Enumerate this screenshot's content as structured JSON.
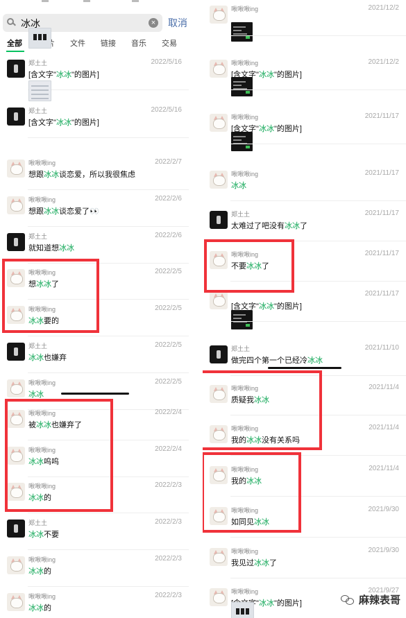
{
  "search": {
    "query": "冰冰",
    "cancel_label": "取消"
  },
  "tabs": [
    {
      "label": "全部",
      "active": true
    },
    {
      "label": "图片"
    },
    {
      "label": "文件"
    },
    {
      "label": "链接"
    },
    {
      "label": "音乐"
    },
    {
      "label": "交易"
    }
  ],
  "left_results": [
    {
      "sender": "郑土土",
      "date": "2022/5/16",
      "avatar": "black",
      "parts": [
        "[含文字\"",
        "冰冰",
        "\"的图片]"
      ],
      "thumb": "light"
    },
    {
      "sender": "郑土土",
      "date": "2022/5/16",
      "avatar": "black",
      "parts": [
        "[含文字\"",
        "冰冰",
        "\"的图片]"
      ],
      "thumb": "keys"
    },
    {
      "sender": "啾啾啾ing",
      "date": "2022/2/7",
      "avatar": "cat",
      "parts": [
        "想跟",
        "冰冰",
        "谈恋爱，所以我很焦虑"
      ]
    },
    {
      "sender": "啾啾啾ing",
      "date": "2022/2/6",
      "avatar": "cat",
      "parts": [
        "想跟",
        "冰冰",
        "谈恋爱了👀"
      ]
    },
    {
      "sender": "郑土土",
      "date": "2022/2/6",
      "avatar": "black",
      "parts": [
        "就知道想",
        "冰冰",
        ""
      ]
    },
    {
      "sender": "啾啾啾ing",
      "date": "2022/2/5",
      "avatar": "cat",
      "parts": [
        "想",
        "冰冰",
        "了"
      ]
    },
    {
      "sender": "啾啾啾ing",
      "date": "2022/2/5",
      "avatar": "cat",
      "parts": [
        "",
        "冰冰",
        "要的"
      ]
    },
    {
      "sender": "郑土土",
      "date": "2022/2/5",
      "avatar": "black",
      "parts": [
        "",
        "冰冰",
        "也嫌弃"
      ]
    },
    {
      "sender": "啾啾啾ing",
      "date": "2022/2/5",
      "avatar": "cat",
      "parts": [
        "",
        "冰冰",
        ""
      ]
    },
    {
      "sender": "啾啾啾ing",
      "date": "2022/2/4",
      "avatar": "cat",
      "parts": [
        "被",
        "冰冰",
        "也嫌弃了"
      ]
    },
    {
      "sender": "啾啾啾ing",
      "date": "2022/2/4",
      "avatar": "cat",
      "parts": [
        "",
        "冰冰",
        "呜呜"
      ]
    },
    {
      "sender": "啾啾啾ing",
      "date": "2022/2/3",
      "avatar": "cat",
      "parts": [
        "",
        "冰冰",
        "的"
      ]
    },
    {
      "sender": "郑土土",
      "date": "2022/2/3",
      "avatar": "black",
      "parts": [
        "",
        "冰冰",
        "不要"
      ]
    },
    {
      "sender": "啾啾啾ing",
      "date": "2022/2/3",
      "avatar": "cat",
      "parts": [
        "",
        "冰冰",
        "的"
      ]
    },
    {
      "sender": "啾啾啾ing",
      "date": "2022/2/3",
      "avatar": "cat",
      "parts": [
        "",
        "冰冰",
        "的"
      ]
    }
  ],
  "right_results": [
    {
      "sender": "啾啾啾ing",
      "date": "2021/12/2",
      "avatar": "cat",
      "parts": [
        "",
        "",
        ""
      ],
      "thumb": "dark"
    },
    {
      "sender": "啾啾啾ing",
      "date": "2021/12/2",
      "avatar": "cat",
      "parts": [
        "[含文字\"",
        "冰冰",
        "\"的图片]"
      ],
      "thumb": "dark"
    },
    {
      "sender": "啾啾啾ing",
      "date": "2021/11/17",
      "avatar": "cat",
      "parts": [
        "[含文字\"",
        "冰冰",
        "\"的图片]"
      ],
      "thumb": "dark"
    },
    {
      "sender": "啾啾啾ing",
      "date": "2021/11/17",
      "avatar": "cat",
      "parts": [
        "",
        "冰冰",
        ""
      ]
    },
    {
      "sender": "郑土土",
      "date": "2021/11/17",
      "avatar": "black",
      "parts": [
        "太难过了吧没有",
        "冰冰",
        "了"
      ]
    },
    {
      "sender": "啾啾啾ing",
      "date": "2021/11/17",
      "avatar": "cat",
      "parts": [
        "不要",
        "冰冰",
        "了"
      ]
    },
    {
      "sender": "",
      "date": "2021/11/17",
      "avatar": "cat",
      "parts": [
        "[含文字\"",
        "冰冰",
        "\"的图片]"
      ],
      "thumb": "dark"
    },
    {
      "sender": "郑土土",
      "date": "2021/11/10",
      "avatar": "black",
      "parts": [
        "做完四个第一个已经冷",
        "冰冰",
        ""
      ]
    },
    {
      "sender": "啾啾啾ing",
      "date": "2021/11/4",
      "avatar": "cat",
      "parts": [
        "质疑我",
        "冰冰",
        ""
      ]
    },
    {
      "sender": "啾啾啾ing",
      "date": "2021/11/4",
      "avatar": "cat",
      "parts": [
        "我的",
        "冰冰",
        "没有关系吗"
      ]
    },
    {
      "sender": "啾啾啾ing",
      "date": "2021/11/4",
      "avatar": "cat",
      "parts": [
        "我的",
        "冰冰",
        ""
      ]
    },
    {
      "sender": "啾啾啾ing",
      "date": "2021/9/30",
      "avatar": "cat",
      "parts": [
        "如同见",
        "冰冰",
        ""
      ]
    },
    {
      "sender": "啾啾啾ing",
      "date": "2021/9/30",
      "avatar": "cat",
      "parts": [
        "我见过",
        "冰冰",
        "了"
      ]
    },
    {
      "sender": "啾啾啾ing",
      "date": "2021/9/27",
      "avatar": "cat",
      "parts": [
        "[含文字\"",
        "冰冰",
        "\"的图片]"
      ],
      "thumb": "light"
    }
  ],
  "watermark": {
    "text": "麻辣表哥"
  }
}
